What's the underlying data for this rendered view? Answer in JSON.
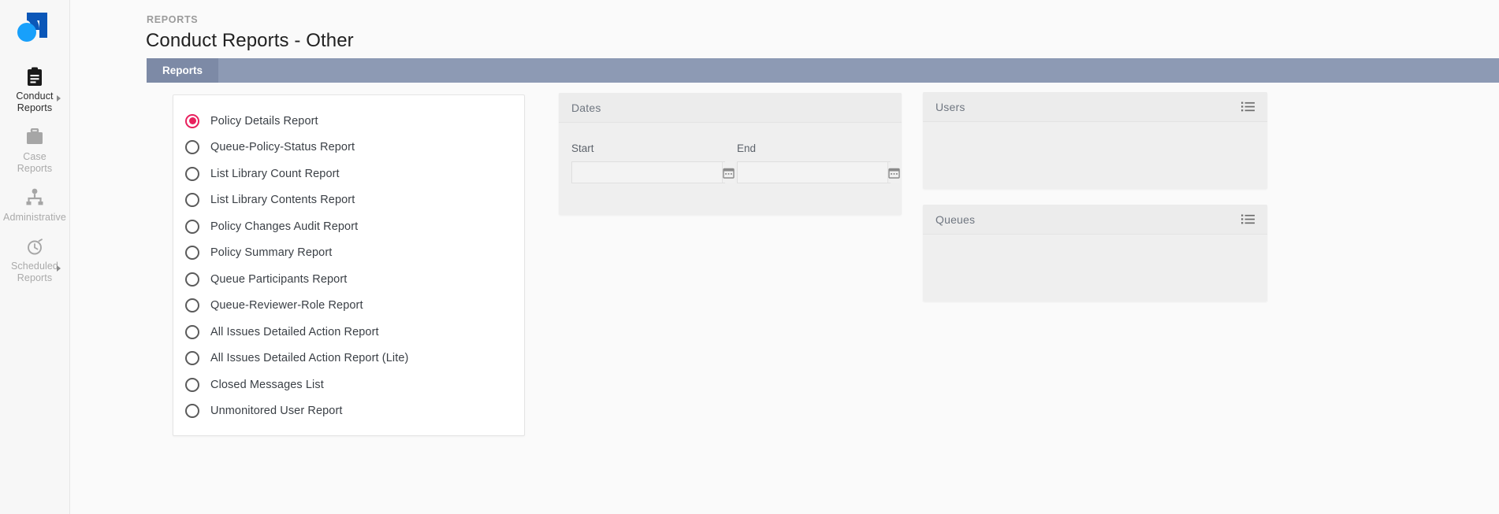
{
  "sidebar": {
    "logo_name": "app-logo",
    "items": [
      {
        "label": "Conduct Reports",
        "icon": "clipboard-icon",
        "active": true,
        "has_caret": true
      },
      {
        "label": "Case Reports",
        "icon": "briefcase-icon",
        "active": false,
        "has_caret": false
      },
      {
        "label": "Administrative",
        "icon": "org-chart-icon",
        "active": false,
        "has_caret": false
      },
      {
        "label": "Scheduled Reports",
        "icon": "stopwatch-icon",
        "active": false,
        "has_caret": true
      }
    ]
  },
  "header": {
    "breadcrumb": "REPORTS",
    "title": "Conduct Reports - Other"
  },
  "tabbar": {
    "tabs": [
      {
        "label": "Reports",
        "active": true
      }
    ],
    "collapse_icon": "chevron-up-icon"
  },
  "report_options": {
    "selected": "Policy Details Report",
    "items": [
      "Policy Details Report",
      "Queue-Policy-Status Report",
      "List Library Count Report",
      "List Library Contents Report",
      "Policy Changes Audit Report",
      "Policy Summary Report",
      "Queue Participants Report",
      "Queue-Reviewer-Role Report",
      "All Issues Detailed Action Report",
      "All Issues Detailed Action Report (Lite)",
      "Closed Messages List",
      "Unmonitored User Report"
    ]
  },
  "dates_panel": {
    "title": "Dates",
    "start": {
      "label": "Start",
      "value": "",
      "placeholder": "",
      "button_icon": "calendar-icon"
    },
    "end": {
      "label": "End",
      "value": "",
      "placeholder": "",
      "button_icon": "calendar-icon"
    }
  },
  "users_panel": {
    "title": "Users",
    "action_icon": "list-icon"
  },
  "queues_panel": {
    "title": "Queues",
    "action_icon": "list-icon"
  },
  "colors": {
    "accent_pink": "#e8215e",
    "tabbar": "#8d9ab4",
    "tab_active": "#7d8aa6",
    "logo_blue_dark": "#0b57b8",
    "logo_blue_light": "#18a0fb",
    "panel_bg": "#efefef",
    "page_bg": "#fafafa"
  }
}
